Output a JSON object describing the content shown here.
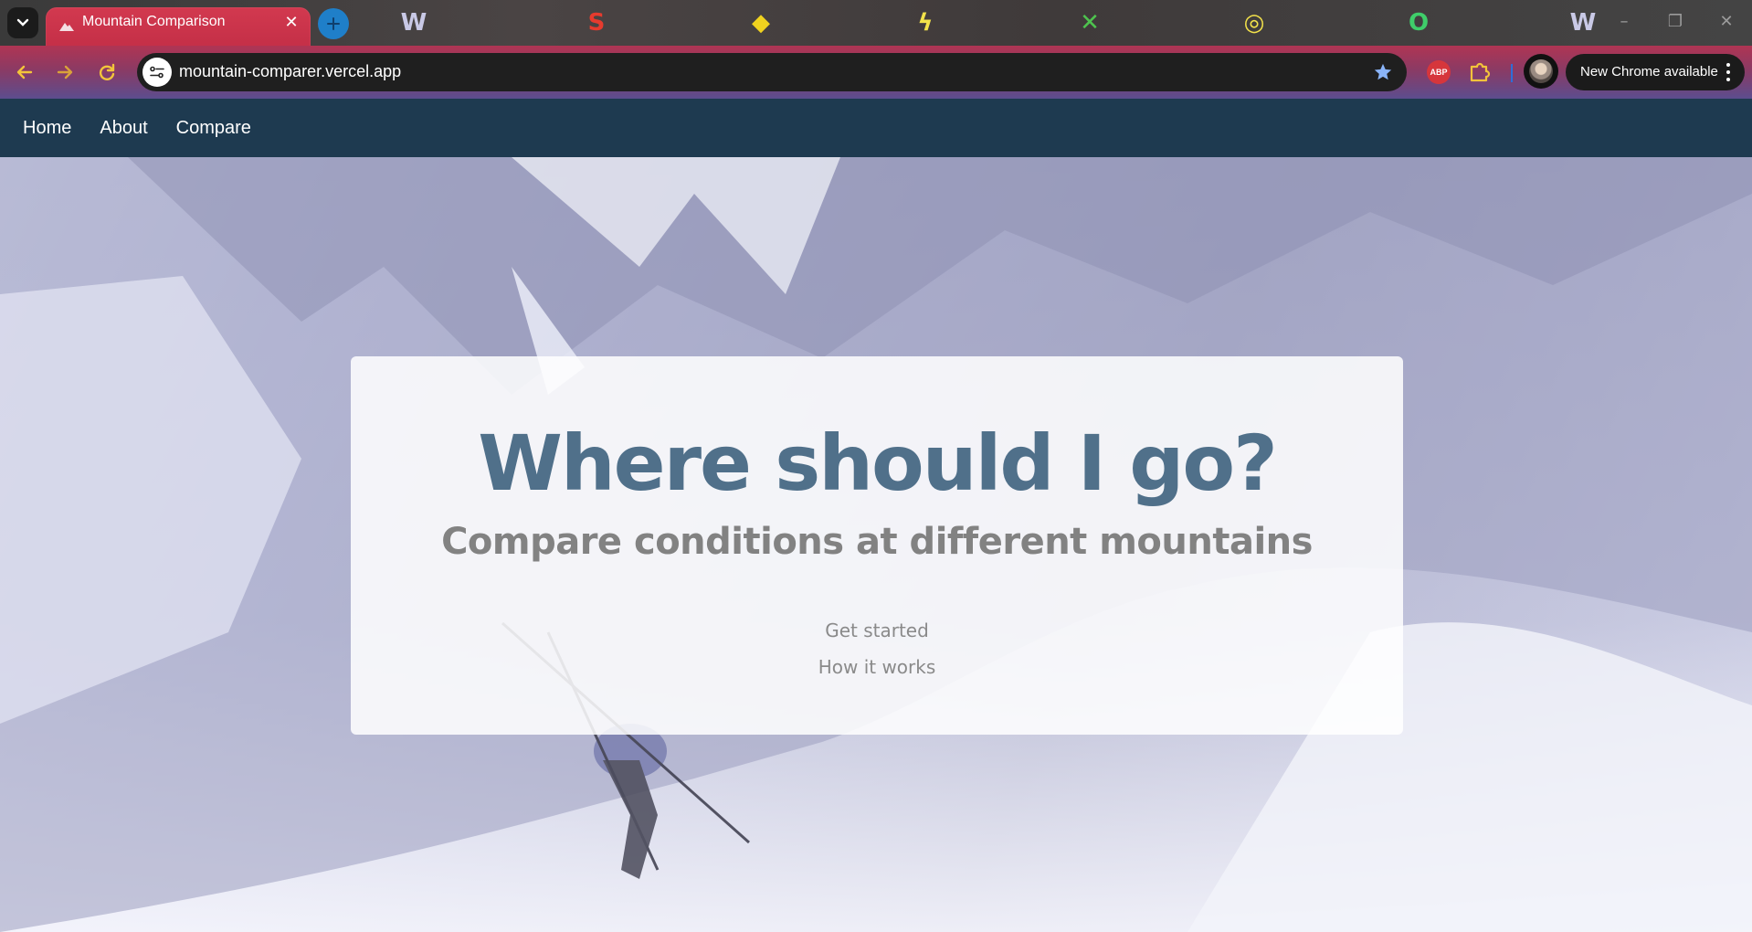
{
  "browser": {
    "tab": {
      "title": "Mountain Comparison",
      "favicon": "mountain-favicon",
      "close_icon": "✕"
    },
    "url": "mountain-comparer.vercel.app",
    "update_chip": {
      "label": "New Chrome available"
    },
    "extensions": {
      "adblock_label": "ABP"
    },
    "theme": {
      "accent": "#c42f47",
      "toolbar_bottom": "#5c4d8e"
    }
  },
  "site_nav": {
    "links": [
      "Home",
      "About",
      "Compare"
    ],
    "background": "#1e3a50"
  },
  "hero": {
    "title": "Where should I go?",
    "subtitle": "Compare conditions at different mountains",
    "buttons": {
      "get_started": "Get started",
      "how_it_works": "How it works"
    },
    "title_color": "#50708a"
  }
}
